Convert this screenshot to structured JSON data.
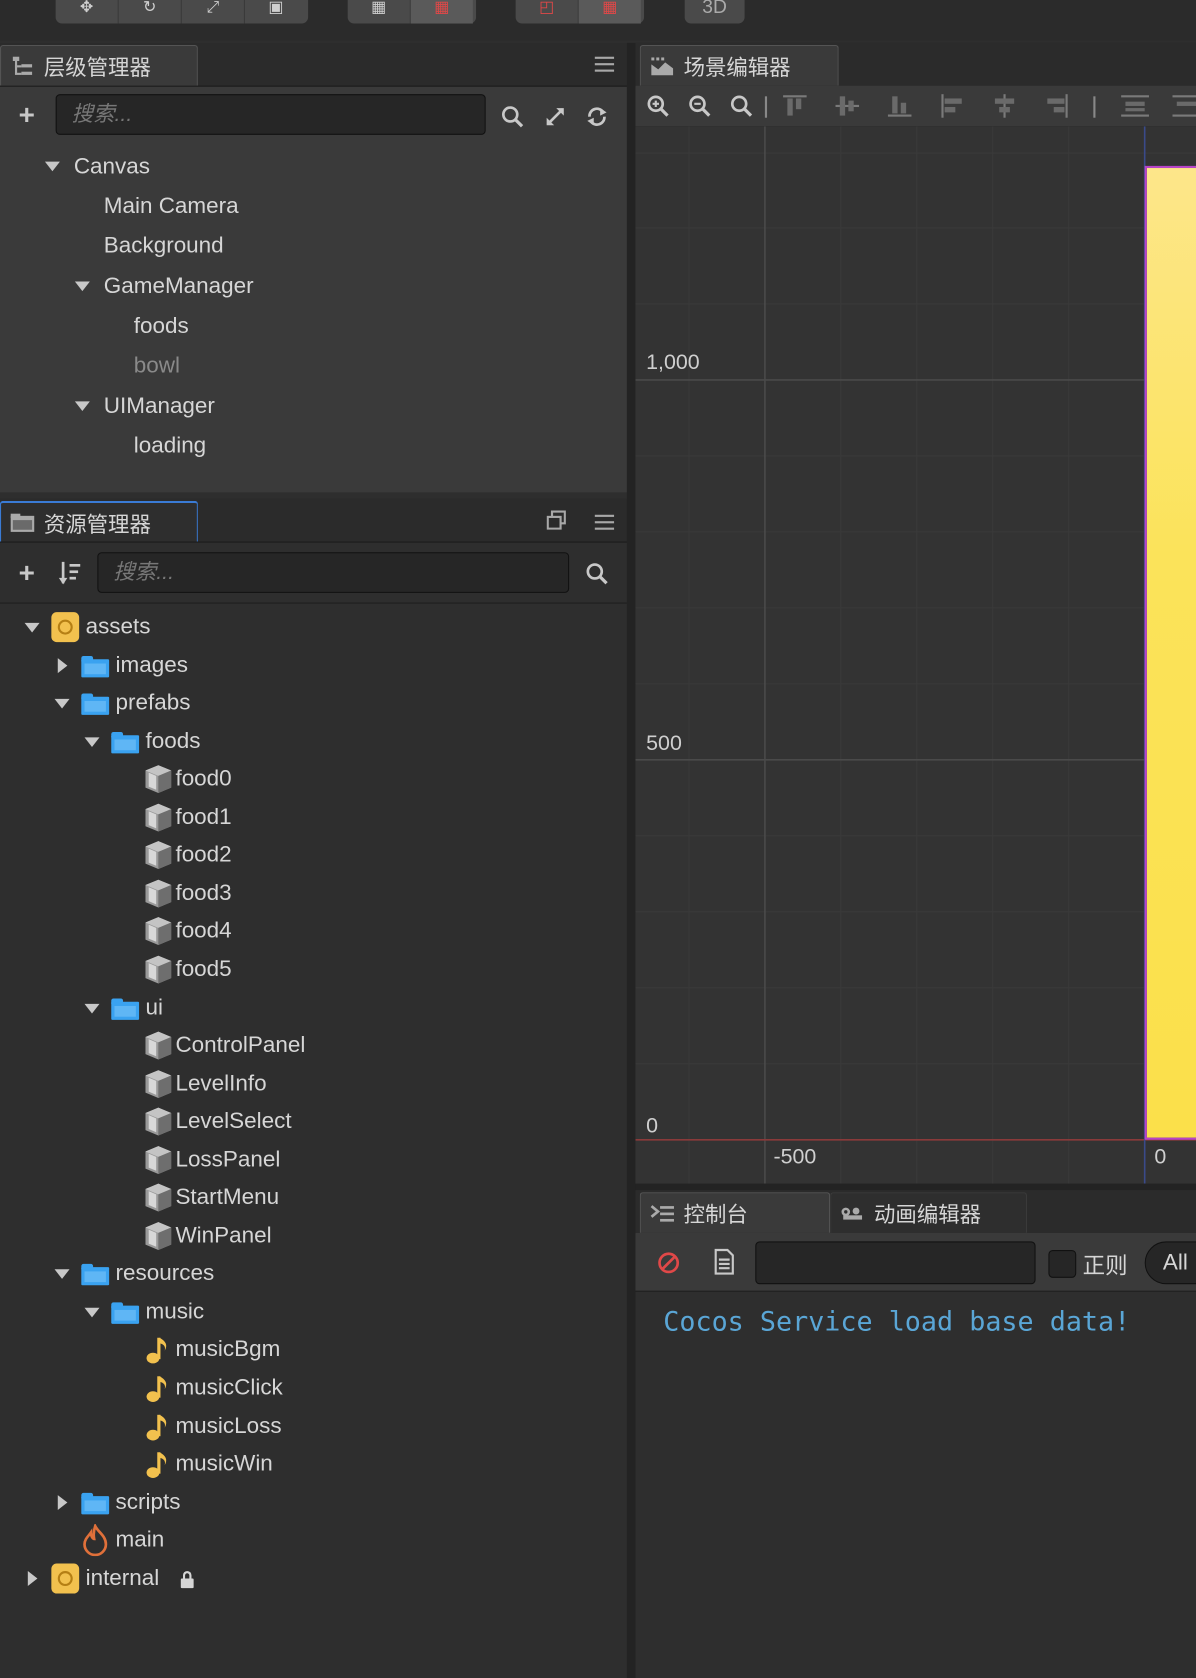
{
  "toolbar": {
    "transform_tools": [
      "move-tool",
      "rotate-tool",
      "scale-tool",
      "rect-tool"
    ],
    "mode_3d_label": "3D"
  },
  "hierarchy": {
    "tab_label": "层级管理器",
    "search_placeholder": "搜索...",
    "nodes": [
      {
        "label": "Canvas",
        "depth": 0,
        "expanded": true
      },
      {
        "label": "Main Camera",
        "depth": 1
      },
      {
        "label": "Background",
        "depth": 1
      },
      {
        "label": "GameManager",
        "depth": 1,
        "expanded": true
      },
      {
        "label": "foods",
        "depth": 2
      },
      {
        "label": "bowl",
        "depth": 2,
        "inactive": true
      },
      {
        "label": "UIManager",
        "depth": 1,
        "expanded": true
      },
      {
        "label": "loading",
        "depth": 2
      }
    ]
  },
  "assets": {
    "tab_label": "资源管理器",
    "search_placeholder": "搜索...",
    "items": [
      {
        "label": "assets",
        "icon": "database-icon",
        "toggle": "down"
      },
      {
        "label": "images",
        "icon": "folder-icon",
        "toggle": "right"
      },
      {
        "label": "prefabs",
        "icon": "folder-icon",
        "toggle": "down"
      },
      {
        "label": "foods",
        "icon": "folder-icon",
        "toggle": "down"
      },
      {
        "label": "food0",
        "icon": "prefab-icon"
      },
      {
        "label": "food1",
        "icon": "prefab-icon"
      },
      {
        "label": "food2",
        "icon": "prefab-icon"
      },
      {
        "label": "food3",
        "icon": "prefab-icon"
      },
      {
        "label": "food4",
        "icon": "prefab-icon"
      },
      {
        "label": "food5",
        "icon": "prefab-icon"
      },
      {
        "label": "ui",
        "icon": "folder-icon",
        "toggle": "down"
      },
      {
        "label": "ControlPanel",
        "icon": "prefab-icon"
      },
      {
        "label": "LevelInfo",
        "icon": "prefab-icon"
      },
      {
        "label": "LevelSelect",
        "icon": "prefab-icon"
      },
      {
        "label": "LossPanel",
        "icon": "prefab-icon"
      },
      {
        "label": "StartMenu",
        "icon": "prefab-icon"
      },
      {
        "label": "WinPanel",
        "icon": "prefab-icon"
      },
      {
        "label": "resources",
        "icon": "folder-icon",
        "toggle": "down"
      },
      {
        "label": "music",
        "icon": "folder-icon",
        "toggle": "down"
      },
      {
        "label": "musicBgm",
        "icon": "audio-icon"
      },
      {
        "label": "musicClick",
        "icon": "audio-icon"
      },
      {
        "label": "musicLoss",
        "icon": "audio-icon"
      },
      {
        "label": "musicWin",
        "icon": "audio-icon"
      },
      {
        "label": "scripts",
        "icon": "folder-icon",
        "toggle": "right"
      },
      {
        "label": "main",
        "icon": "scene-icon"
      },
      {
        "label": "internal",
        "icon": "database-icon",
        "toggle": "right",
        "locked": true
      }
    ]
  },
  "scene": {
    "tab_label": "场景编辑器",
    "y_ruler": [
      "1,000",
      "500",
      "0"
    ],
    "x_ruler": [
      "-500",
      "0"
    ],
    "canvas_color": "#fbe35a"
  },
  "console": {
    "tab_label": "控制台",
    "anim_tab_label": "动画编辑器",
    "regex_label": "正则",
    "filter_label": "All",
    "log_lines": [
      "Cocos Service load base data!"
    ]
  },
  "colors": {
    "accent_blue": "#3a7bd5",
    "folder_blue": "#3aa2f0",
    "asset_gold": "#f2c14e",
    "console_text": "#5aa6d6",
    "error_red": "#e04848"
  }
}
